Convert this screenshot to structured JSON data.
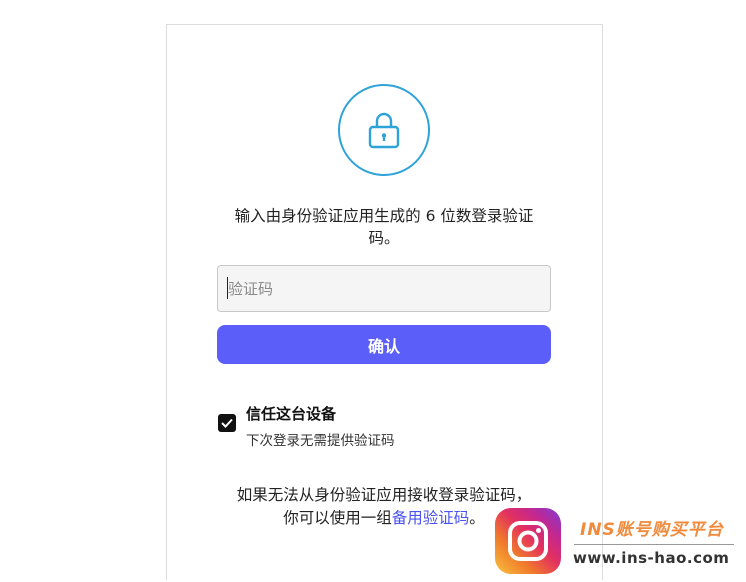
{
  "prompt": {
    "line1": "输入由身份验证应用生成的 6 位数登录验证",
    "line2": "码。"
  },
  "code_input": {
    "placeholder": "验证码",
    "value": ""
  },
  "confirm_button": {
    "label": "确认"
  },
  "trust_device": {
    "checked": true,
    "title": "信任这台设备",
    "subtitle": "下次登录无需提供验证码"
  },
  "help": {
    "line1": "如果无法从身份验证应用接收登录验证码，",
    "line2_prefix": "你可以使用一组",
    "backup_link": "备用验证码",
    "line2_suffix": "。"
  },
  "watermark": {
    "title": "INS账号购买平台",
    "url": "www.ins-hao.com"
  },
  "colors": {
    "accent": "#5b5ef8",
    "lock_ring": "#2da3d8",
    "link": "#4b53f0"
  }
}
